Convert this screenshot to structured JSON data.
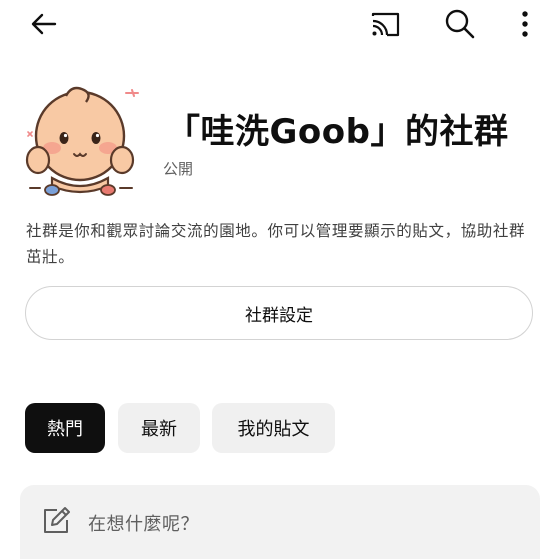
{
  "topbar": {
    "icons": {
      "back": "arrow-left-icon",
      "cast": "cast-icon",
      "search": "search-icon",
      "more": "more-vertical-icon"
    }
  },
  "community": {
    "title": "「哇洗Goob」的社群",
    "visibility": "公開",
    "description": "社群是你和觀眾討論交流的園地。你可以管理要顯示的貼文，協助社群茁壯。",
    "settings_label": "社群設定"
  },
  "filters": {
    "chips": [
      {
        "label": "熱門",
        "selected": true
      },
      {
        "label": "最新",
        "selected": false
      },
      {
        "label": "我的貼文",
        "selected": false
      }
    ]
  },
  "composer": {
    "placeholder": "在想什麼呢？",
    "icon": "edit-icon"
  },
  "colors": {
    "text": "#0f0f0f",
    "secondary_text": "#606060",
    "chip_selected_bg": "#0f0f0f",
    "chip_bg": "#f0f0f0",
    "composer_bg": "#f2f2f2",
    "avatar_skin": "#f8c9a4"
  }
}
